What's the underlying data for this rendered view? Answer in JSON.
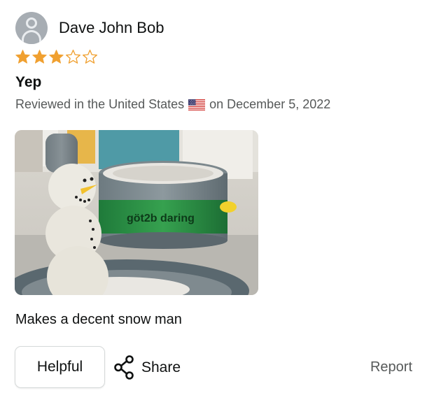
{
  "review": {
    "author": "Dave John Bob",
    "avatar_icon": "user-silhouette-icon",
    "rating": 3,
    "rating_max": 5,
    "star_color": "#f0a030",
    "title": "Yep",
    "meta_prefix": "Reviewed in the United States",
    "flag_icon": "us-flag-icon",
    "meta_date": "on December 5, 2022",
    "image_icon": "review-photo-snowman",
    "body": "Makes a decent snow man",
    "product_label": "göt2b daring",
    "actions": {
      "helpful": "Helpful",
      "share": "Share",
      "report": "Report"
    }
  }
}
